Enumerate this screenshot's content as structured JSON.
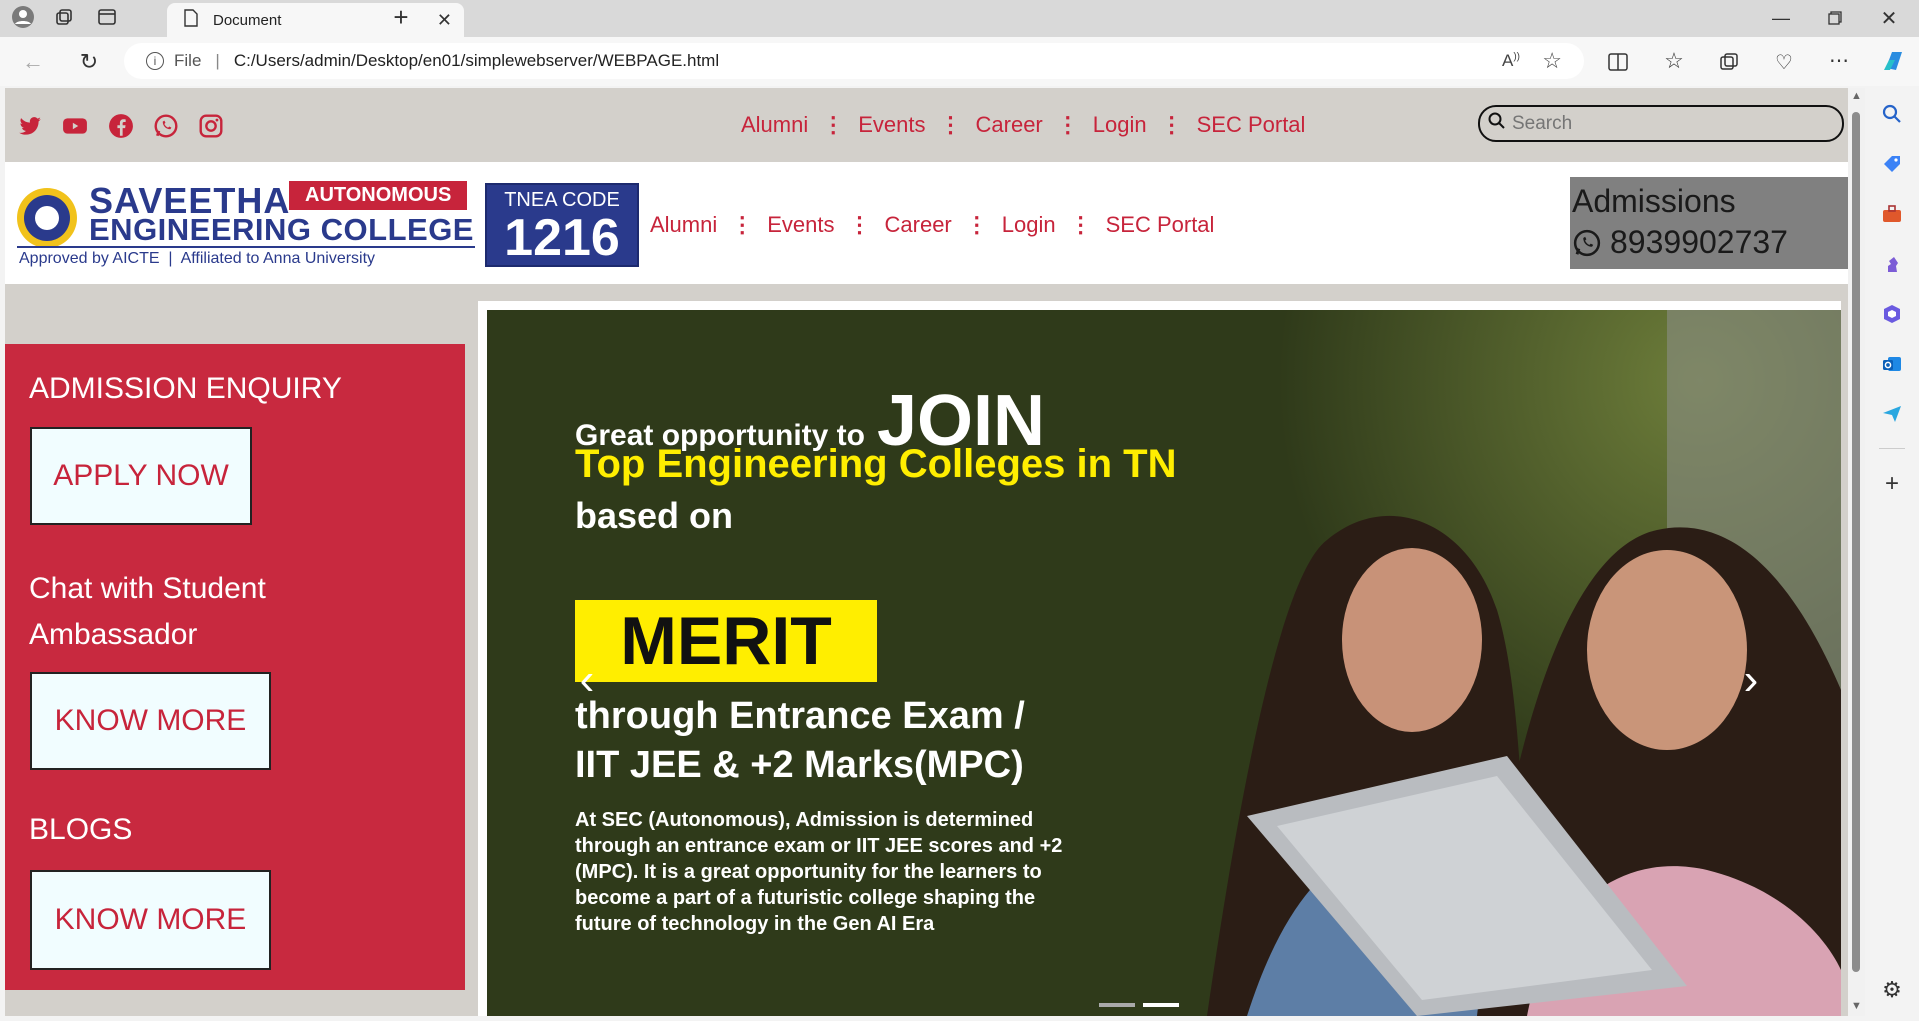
{
  "browser": {
    "tab_title": "Document",
    "url_prefix": "File",
    "url": "C:/Users/admin/Desktop/en01/simplewebserver/WEBPAGE.html"
  },
  "topstrip": {
    "nav": [
      "Alumni",
      "Events",
      "Career",
      "Login",
      "SEC Portal"
    ],
    "search_placeholder": "Search",
    "social_icons": [
      "twitter-icon",
      "youtube-icon",
      "facebook-icon",
      "whatsapp-icon",
      "instagram-icon"
    ]
  },
  "header": {
    "logo_name_1": "SAVEETHA",
    "logo_name_2": "ENGINEERING COLLEGE",
    "logo_badge": "AUTONOMOUS",
    "logo_tagline": "Approved by AICTE  |  Affiliated to Anna University",
    "tnea_label": "TNEA CODE",
    "tnea_code": "1216",
    "nav": [
      "Alumni",
      "Events",
      "Career",
      "Login",
      "SEC Portal"
    ],
    "admissions_label": "Admissions",
    "admissions_phone": "8939902737"
  },
  "left_panel": {
    "enquiry_heading": "ADMISSION ENQUIRY",
    "apply_button": "APPLY NOW",
    "chat_text": "Chat with Student Ambassador",
    "chat_button": "KNOW MORE",
    "blogs_heading": "BLOGS",
    "blogs_button": "KNOW MORE"
  },
  "slide": {
    "line1a": "Great opportunity to",
    "line1b": "JOIN",
    "line2": "Top Engineering Colleges in TN",
    "line3": "based on",
    "merit": "MERIT",
    "line4": "through Entrance Exam /",
    "line5": "IIT JEE & +2 Marks(MPC)",
    "para": "At SEC (Autonomous), Admission is determined through an entrance exam or  IIT JEE scores and +2 (MPC). It is a great opportunity for the learners to become a part of a futuristic college shaping the future of technology in the Gen AI Era"
  },
  "colors": {
    "accent_red": "#c7243b",
    "panel_red": "#c8293f",
    "strip_gray": "#d3d0cb",
    "merit_yellow": "#ffee00",
    "navy": "#2a3a8c"
  }
}
